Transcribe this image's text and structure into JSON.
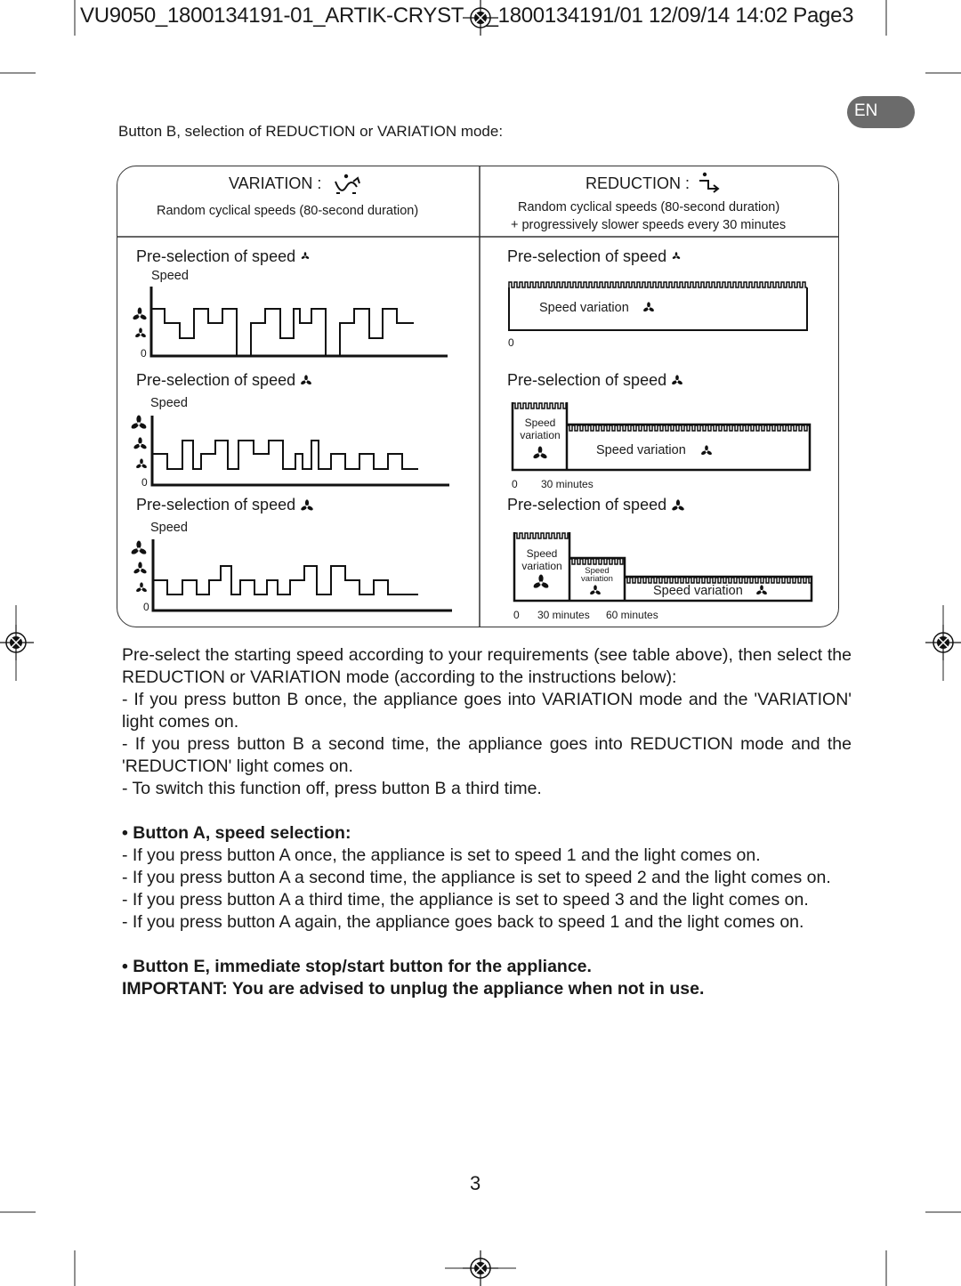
{
  "header": {
    "text": "VU9050_1800134191-01_ARTIK-CRYST    _1800134191/01  12/09/14  14:02  Page3"
  },
  "lang_badge": "EN",
  "intro": "Button B, selection of REDUCTION or VARIATION mode:",
  "table": {
    "variation": {
      "title": "VARIATION  :",
      "desc": "Random cyclical speeds (80-second duration)",
      "icon": "variation-wave-icon"
    },
    "reduction": {
      "title": "REDUCTION  :",
      "desc1": "Random cyclical speeds (80-second duration)",
      "desc2": "+ progressively slower speeds every 30 minutes",
      "icon": "reduction-step-arrow-icon"
    },
    "preselection": "Pre-selection of speed",
    "speed": "Speed",
    "zero": "0",
    "speed_variation": "Speed variation",
    "speed_variation_short": [
      "Speed",
      "variation"
    ],
    "minutes30": "30 minutes",
    "minutes60": "60 minutes"
  },
  "instructions": {
    "p1": "Pre-select the starting speed according to your requirements (see table above), then select the REDUCTION or VARIATION mode (according to the instructions below):",
    "p2": "- If you press button B once, the appliance goes into VARIATION mode and the 'VARIATION' light comes on.",
    "p3": "- If you press button B a second time, the appliance goes into REDUCTION mode and the 'REDUCTION' light comes on.",
    "p4": "- To switch this function off, press button B a third time.",
    "buttonA_heading": "• Button A, speed selection:",
    "a1": "- If you press button A once, the appliance is set to speed 1 and the light comes on.",
    "a2": "- If you press button A a second time, the appliance is set to speed 2 and the light comes on.",
    "a3": "- If you press button A a third time, the appliance is set to speed 3 and the light comes on.",
    "a4": "- If you press button A again, the appliance goes back to speed 1 and the light comes on.",
    "buttonE": "• Button E, immediate stop/start button for the appliance.",
    "important": "IMPORTANT: You are advised to unplug the appliance when not in use."
  },
  "page_number": "3"
}
